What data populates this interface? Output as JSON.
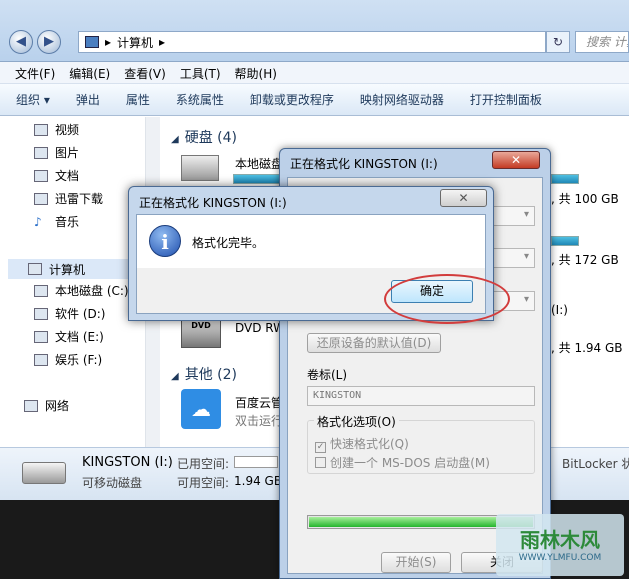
{
  "explorer": {
    "address": {
      "path": "计算机",
      "search_placeholder": "搜索 计算"
    },
    "menu": [
      "文件(F)",
      "编辑(E)",
      "查看(V)",
      "工具(T)",
      "帮助(H)"
    ],
    "toolbar": [
      "组织 ▾",
      "弹出",
      "属性",
      "系统属性",
      "卸载或更改程序",
      "映射网络驱动器",
      "打开控制面板"
    ],
    "sidebar": {
      "libraries": [
        "视频",
        "图片",
        "文档",
        "迅雷下载",
        "音乐"
      ],
      "computer": "计算机",
      "drives": [
        "本地磁盘 (C:)",
        "软件 (D:)",
        "文档 (E:)",
        "娱乐 (F:)"
      ],
      "network": "网络"
    },
    "content": {
      "hdd_group": "硬盘 (4)",
      "local_disk": "本地磁盘",
      "drive_info": [
        ", 共 100 GB",
        ", 共 172 GB",
        ", 共 1.94 GB"
      ],
      "dvd_label": "DVD RW",
      "partial_i": "(I:)",
      "other_group": "其他 (2)",
      "baidu_name": "百度云管",
      "baidu_sub": "双击运行"
    },
    "status": {
      "drive_name": "KINGSTON (I:)",
      "drive_type": "可移动磁盘",
      "used_label": "已用空间:",
      "free_label": "可用空间:",
      "free_value": "1.94 GB",
      "bitlocker": "BitLocker 状"
    }
  },
  "format_dialog": {
    "title": "正在格式化 KINGSTON (I:)",
    "restore_button": "还原设备的默认值(D)",
    "volume_label_title": "卷标(L)",
    "volume_label_value": "KINGSTON",
    "options_title": "格式化选项(O)",
    "quick_format": "快速格式化(Q)",
    "msdos_disk": "创建一个 MS-DOS 启动盘(M)",
    "progress": 1.0,
    "start_button": "开始(S)",
    "close_button": "关闭"
  },
  "message_box": {
    "title": "正在格式化 KINGSTON (I:)",
    "text": "格式化完毕。",
    "ok_button": "确定",
    "close_glyph": "✕"
  },
  "watermark": {
    "title": "雨林木风",
    "url": "WWW.YLMFU.COM"
  },
  "colors": {
    "accent": "#1e395b",
    "progress": "#24b52d",
    "highlight_ring": "#d23c3c"
  }
}
